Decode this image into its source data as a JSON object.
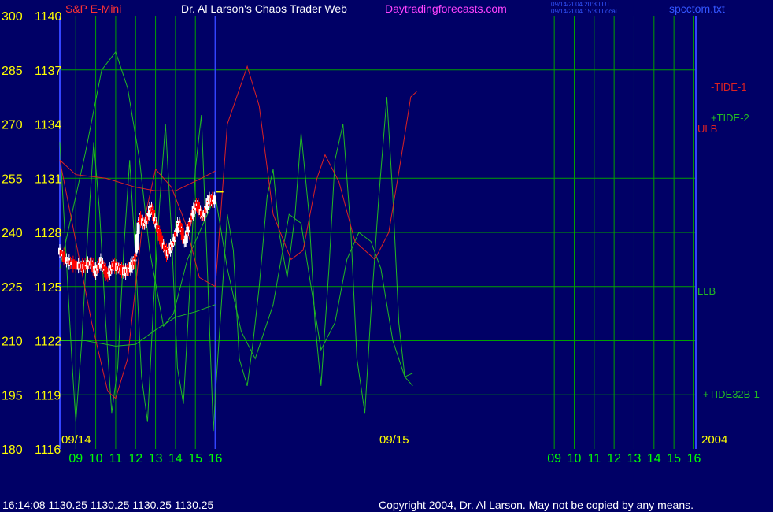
{
  "header": {
    "symbol": "S&P E-Mini",
    "title": "Dr. Al Larson's Chaos Trader Web",
    "site": "Daytradingforecasts.com",
    "timestamp_ut": "09/14/2004 20:30 UT",
    "timestamp_local": "09/14/2004 15:30 Local",
    "file": "spcctom.txt"
  },
  "footer": {
    "quote": "16:14:08  1130.25 1130.25 1130.25 1130.25",
    "copyright": "Copyright 2004, Dr. Al Larson. May not be copied by any means."
  },
  "colors": {
    "background": "#000066",
    "grid": "#00a000",
    "price_up": "#ffffff",
    "price_down": "#ff0000",
    "tide1": "#dd2222",
    "tide2": "#22bb22",
    "tide32b": "#22bb22",
    "ulb": "#dd2222",
    "llb": "#22bb22",
    "axis_label": "#ffff00",
    "hour_label": "#00ff00",
    "divider": "#3344ff"
  },
  "chart_data": {
    "type": "line",
    "y_left_scale": [
      180,
      195,
      210,
      225,
      240,
      255,
      270,
      285,
      300
    ],
    "y_price_scale": [
      1116,
      1119,
      1122,
      1125,
      1128,
      1131,
      1134,
      1137,
      1140
    ],
    "ylim": [
      1116,
      1140
    ],
    "x_hours": [
      "09",
      "10",
      "11",
      "12",
      "13",
      "14",
      "15",
      "16",
      "09",
      "10",
      "11",
      "12",
      "13",
      "14",
      "15",
      "16"
    ],
    "x_hour_values": [
      9,
      10,
      11,
      12,
      13,
      14,
      15,
      16,
      33,
      34,
      35,
      36,
      37,
      38,
      39,
      40
    ],
    "xlim": [
      8.2,
      40.1
    ],
    "date_labels": [
      "09/14",
      "09/15",
      "2004"
    ],
    "series_labels": {
      "tide1": "-TIDE-1",
      "tide2": "+TIDE-2",
      "ulb": "ULB",
      "llb": "LLB",
      "tide32b": "+TIDE32B-1"
    },
    "price": [
      [
        8.2,
        1127.0
      ],
      [
        8.6,
        1126.4
      ],
      [
        9.0,
        1126.2
      ],
      [
        9.4,
        1126.1
      ],
      [
        9.8,
        1126.3
      ],
      [
        10.0,
        1125.8
      ],
      [
        10.3,
        1126.4
      ],
      [
        10.6,
        1125.6
      ],
      [
        10.9,
        1126.2
      ],
      [
        11.2,
        1126.0
      ],
      [
        11.5,
        1125.8
      ],
      [
        11.8,
        1126.1
      ],
      [
        12.0,
        1126.5
      ],
      [
        12.2,
        1128.8
      ],
      [
        12.5,
        1128.4
      ],
      [
        12.8,
        1129.4
      ],
      [
        13.0,
        1128.6
      ],
      [
        13.3,
        1127.6
      ],
      [
        13.6,
        1126.8
      ],
      [
        13.9,
        1127.4
      ],
      [
        14.2,
        1128.6
      ],
      [
        14.5,
        1127.4
      ],
      [
        14.8,
        1128.8
      ],
      [
        15.1,
        1129.6
      ],
      [
        15.4,
        1128.8
      ],
      [
        15.7,
        1129.8
      ],
      [
        16.0,
        1129.8
      ]
    ],
    "last_price": 1130.25,
    "tide1": [
      [
        8.2,
        1132.0
      ],
      [
        9.0,
        1127.5
      ],
      [
        9.8,
        1123.0
      ],
      [
        10.6,
        1119.2
      ],
      [
        11.0,
        1118.8
      ],
      [
        11.6,
        1121.0
      ],
      [
        12.3,
        1128.0
      ],
      [
        13.0,
        1131.5
      ],
      [
        13.8,
        1130.5
      ],
      [
        14.5,
        1128.5
      ],
      [
        15.2,
        1125.5
      ],
      [
        16.0,
        1125.0
      ],
      [
        16.6,
        1134.0
      ],
      [
        17.6,
        1137.2
      ],
      [
        18.2,
        1135.0
      ],
      [
        18.9,
        1129.0
      ],
      [
        19.8,
        1126.5
      ],
      [
        20.4,
        1127.0
      ],
      [
        21.1,
        1131.0
      ],
      [
        21.5,
        1132.3
      ],
      [
        22.2,
        1130.8
      ],
      [
        23.0,
        1127.5
      ],
      [
        24.0,
        1126.5
      ],
      [
        24.7,
        1128.0
      ],
      [
        25.3,
        1132.0
      ],
      [
        25.8,
        1135.5
      ],
      [
        26.1,
        1135.8
      ]
    ],
    "tide2": [
      [
        8.2,
        1126.0
      ],
      [
        8.8,
        1129.0
      ],
      [
        9.5,
        1132.5
      ],
      [
        10.3,
        1137.0
      ],
      [
        11.0,
        1138.0
      ],
      [
        11.6,
        1136.0
      ],
      [
        12.2,
        1132.0
      ],
      [
        12.7,
        1127.0
      ],
      [
        13.4,
        1122.8
      ],
      [
        13.9,
        1123.5
      ],
      [
        14.6,
        1126.5
      ],
      [
        15.4,
        1128.5
      ],
      [
        16.0,
        1130.0
      ],
      [
        16.6,
        1126.0
      ],
      [
        17.3,
        1122.5
      ],
      [
        18.0,
        1121.0
      ],
      [
        18.9,
        1124.0
      ],
      [
        19.7,
        1129.0
      ],
      [
        20.3,
        1128.5
      ],
      [
        20.8,
        1125.0
      ],
      [
        21.3,
        1121.5
      ],
      [
        22.0,
        1123.0
      ],
      [
        22.6,
        1126.5
      ],
      [
        23.2,
        1128.0
      ],
      [
        23.8,
        1127.5
      ],
      [
        24.3,
        1126.0
      ],
      [
        24.9,
        1122.0
      ],
      [
        25.5,
        1120.0
      ],
      [
        25.9,
        1120.2
      ]
    ],
    "tide32b": [
      [
        8.2,
        1133.0
      ],
      [
        8.5,
        1127.0
      ],
      [
        8.8,
        1121.0
      ],
      [
        9.0,
        1117.5
      ],
      [
        9.3,
        1122.0
      ],
      [
        9.6,
        1128.0
      ],
      [
        9.9,
        1133.0
      ],
      [
        10.2,
        1129.0
      ],
      [
        10.5,
        1123.0
      ],
      [
        10.8,
        1118.0
      ],
      [
        11.1,
        1120.5
      ],
      [
        11.4,
        1127.0
      ],
      [
        11.7,
        1132.0
      ],
      [
        12.0,
        1126.5
      ],
      [
        12.3,
        1120.0
      ],
      [
        12.6,
        1117.5
      ],
      [
        12.9,
        1124.0
      ],
      [
        13.2,
        1129.5
      ],
      [
        13.5,
        1134.0
      ],
      [
        13.8,
        1128.0
      ],
      [
        14.1,
        1120.5
      ],
      [
        14.4,
        1118.5
      ],
      [
        14.7,
        1124.5
      ],
      [
        15.0,
        1131.5
      ],
      [
        15.3,
        1134.5
      ],
      [
        15.6,
        1126.0
      ],
      [
        15.9,
        1117.0
      ],
      [
        16.0,
        1119.0
      ],
      [
        16.3,
        1124.0
      ],
      [
        16.6,
        1129.0
      ],
      [
        16.9,
        1127.0
      ],
      [
        17.2,
        1121.0
      ],
      [
        17.6,
        1119.5
      ],
      [
        17.9,
        1122.0
      ],
      [
        18.2,
        1125.0
      ],
      [
        18.6,
        1130.0
      ],
      [
        18.9,
        1131.5
      ],
      [
        19.2,
        1128.0
      ],
      [
        19.6,
        1125.5
      ],
      [
        20.0,
        1129.0
      ],
      [
        20.3,
        1133.5
      ],
      [
        20.7,
        1129.0
      ],
      [
        21.0,
        1123.0
      ],
      [
        21.3,
        1119.5
      ],
      [
        21.7,
        1126.0
      ],
      [
        22.0,
        1132.0
      ],
      [
        22.4,
        1134.0
      ],
      [
        22.8,
        1128.0
      ],
      [
        23.1,
        1121.0
      ],
      [
        23.5,
        1118.0
      ],
      [
        23.8,
        1123.5
      ],
      [
        24.2,
        1130.0
      ],
      [
        24.6,
        1135.5
      ],
      [
        24.9,
        1130.0
      ],
      [
        25.2,
        1123.0
      ],
      [
        25.5,
        1120.0
      ],
      [
        25.9,
        1119.5
      ]
    ],
    "ulb": [
      [
        8.2,
        1132.0
      ],
      [
        9.0,
        1131.2
      ],
      [
        10.5,
        1131.0
      ],
      [
        12.0,
        1130.5
      ],
      [
        13.0,
        1130.3
      ],
      [
        14.0,
        1130.3
      ],
      [
        15.3,
        1131.0
      ],
      [
        16.0,
        1131.4
      ]
    ],
    "llb": [
      [
        8.2,
        1122.0
      ],
      [
        9.5,
        1122.0
      ],
      [
        11.0,
        1121.7
      ],
      [
        12.0,
        1121.8
      ],
      [
        13.0,
        1122.6
      ],
      [
        14.0,
        1123.3
      ],
      [
        15.0,
        1123.6
      ],
      [
        16.0,
        1124.0
      ]
    ]
  }
}
